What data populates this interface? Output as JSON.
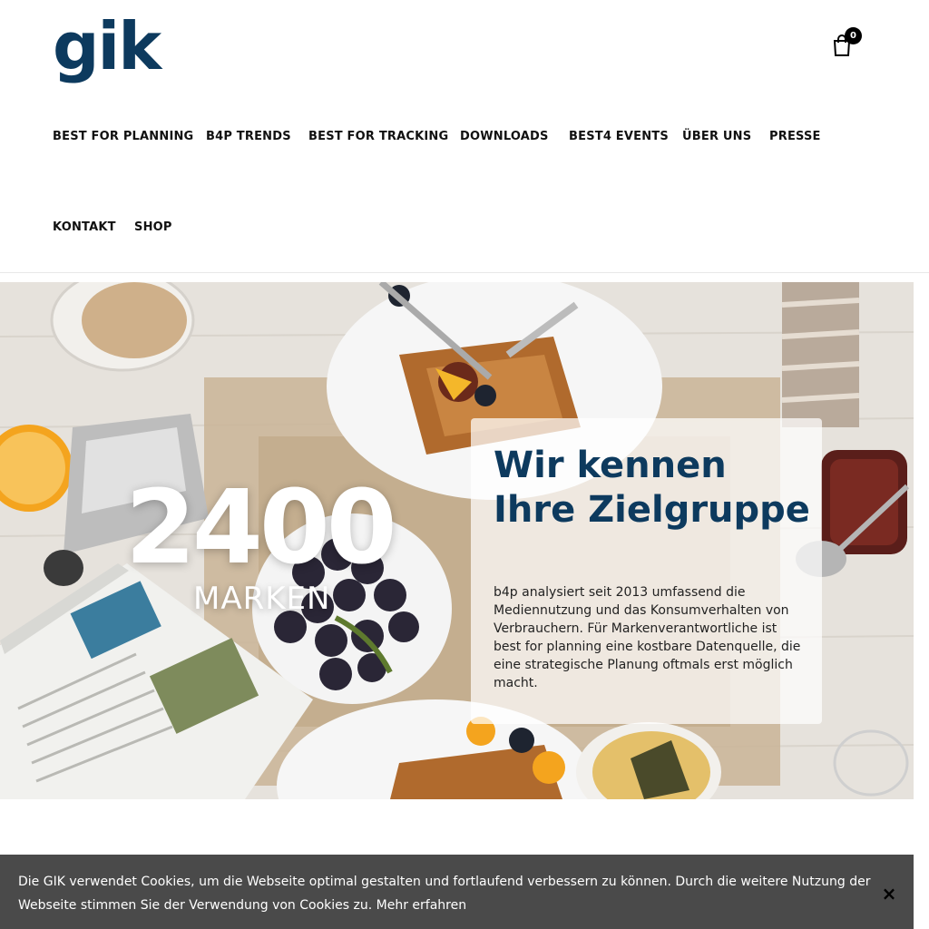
{
  "brand": {
    "logo_text": "gik",
    "primary_color": "#0d3a5e"
  },
  "cart": {
    "count": "0",
    "icon": "shopping-bag-icon"
  },
  "nav": {
    "items": [
      {
        "label": "BEST FOR PLANNING"
      },
      {
        "label": "B4P TRENDS"
      },
      {
        "label": "BEST FOR TRACKING"
      },
      {
        "label": "DOWNLOADS"
      },
      {
        "label": "BEST4 EVENTS"
      },
      {
        "label": "ÜBER UNS"
      },
      {
        "label": "PRESSE"
      },
      {
        "label": "KONTAKT"
      },
      {
        "label": "SHOP"
      }
    ]
  },
  "hero": {
    "number": "2400",
    "number_label": "MARKEN",
    "panel": {
      "title": "Wir kennen Ihre Zielgruppe",
      "text": "b4p analysiert seit 2013 umfassend die Mediennutzung und das Konsumverhalten von Verbrauchern. Für Markenverantwortliche ist best for planning eine kostbare Datenquelle, die eine strategische Planung oftmals erst möglich macht."
    }
  },
  "cookie_banner": {
    "text": "Die GIK verwendet Cookies, um die Webseite optimal gestalten und fortlaufend verbessern zu können. Durch die weitere Nutzung der Webseite stimmen Sie der Verwendung von Cookies zu. ",
    "link_label": "Mehr erfahren",
    "close_label": "×",
    "background": "#4a4a4a"
  }
}
